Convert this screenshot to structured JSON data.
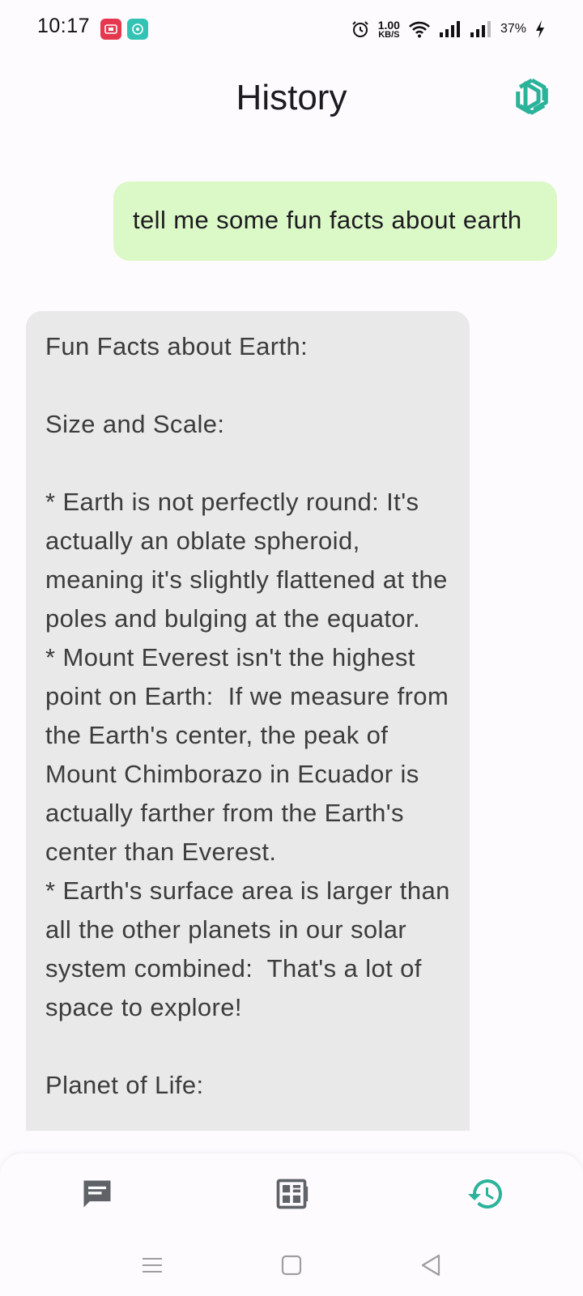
{
  "status_bar": {
    "time": "10:17",
    "net_speed_value": "1.00",
    "net_speed_unit": "KB/S",
    "battery_percent": "37%"
  },
  "header": {
    "title": "History"
  },
  "chat": {
    "messages": [
      {
        "role": "user",
        "text": "tell me some fun facts about earth"
      },
      {
        "role": "assistant",
        "text": "Fun Facts about Earth:\n\nSize and Scale:\n\n* Earth is not perfectly round: It's actually an oblate spheroid, meaning it's slightly flattened at the poles and bulging at the equator.\n* Mount Everest isn't the highest point on Earth:  If we measure from the Earth's center, the peak of Mount Chimborazo in Ecuador is actually farther from the Earth's center than Everest.\n* Earth's surface area is larger than all the other planets in our solar system combined:  That's a lot of space to explore!\n\nPlanet of Life:"
      }
    ]
  },
  "bottom_nav": {
    "items": [
      {
        "icon": "chat-icon",
        "active": false
      },
      {
        "icon": "apps-icon",
        "active": false
      },
      {
        "icon": "history-icon",
        "active": true
      }
    ]
  },
  "colors": {
    "accent": "#2bb39a",
    "user_bubble": "#dbf8c7",
    "bot_bubble": "#e9e9e9",
    "inactive_icon": "#5f6368"
  }
}
